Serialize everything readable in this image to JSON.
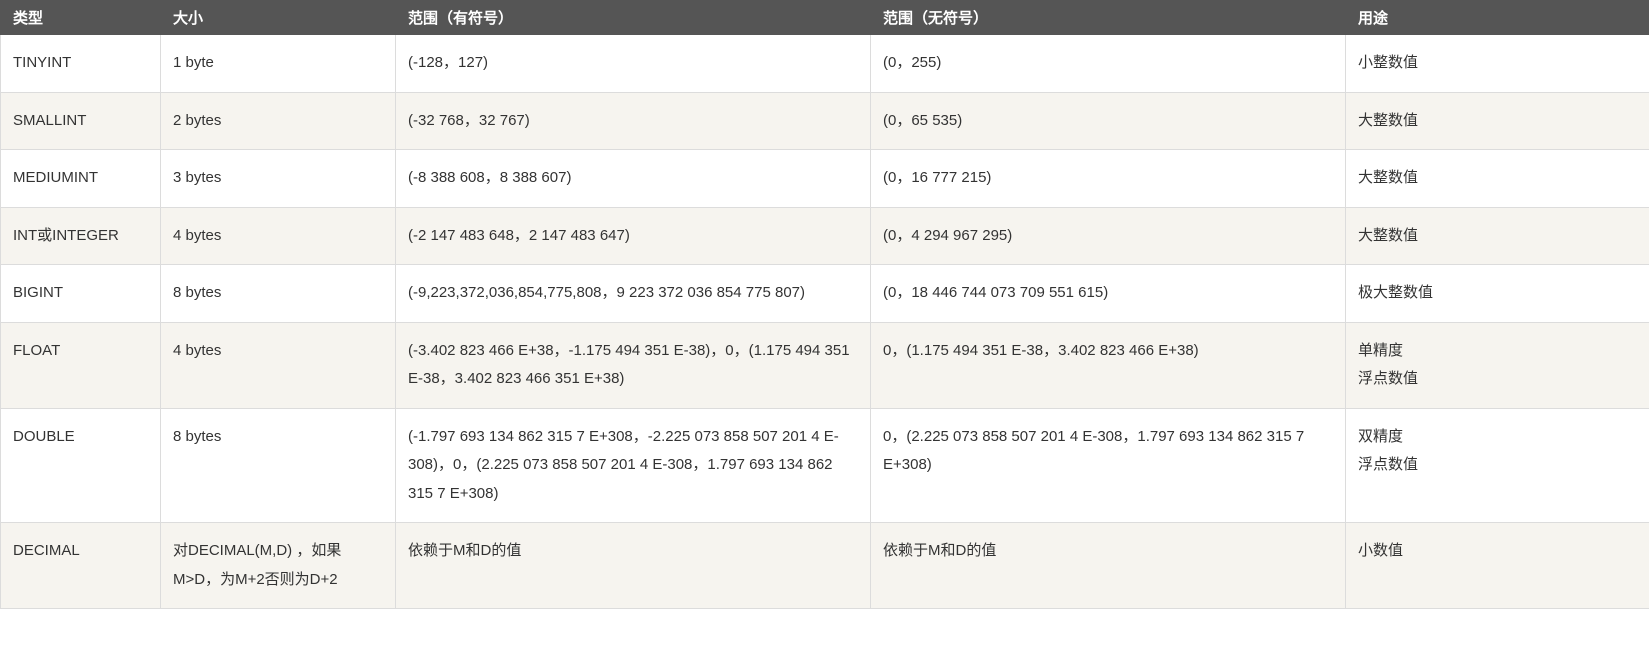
{
  "table": {
    "headers": [
      "类型",
      "大小",
      "范围（有符号）",
      "范围（无符号）",
      "用途"
    ],
    "rows": [
      {
        "type": "TINYINT",
        "size": "1 byte",
        "signed": "(-128，127)",
        "unsigned": "(0，255)",
        "usage": "小整数值"
      },
      {
        "type": "SMALLINT",
        "size": "2 bytes",
        "signed": "(-32 768，32 767)",
        "unsigned": "(0，65 535)",
        "usage": "大整数值"
      },
      {
        "type": "MEDIUMINT",
        "size": "3 bytes",
        "signed": "(-8 388 608，8 388 607)",
        "unsigned": "(0，16 777 215)",
        "usage": "大整数值"
      },
      {
        "type": "INT或INTEGER",
        "size": "4 bytes",
        "signed": "(-2 147 483 648，2 147 483 647)",
        "unsigned": "(0，4 294 967 295)",
        "usage": "大整数值"
      },
      {
        "type": "BIGINT",
        "size": "8 bytes",
        "signed": "(-9,223,372,036,854,775,808，9 223 372 036 854 775 807)",
        "unsigned": "(0，18 446 744 073 709 551 615)",
        "usage": "极大整数值"
      },
      {
        "type": "FLOAT",
        "size": "4 bytes",
        "signed": "(-3.402 823 466 E+38，-1.175 494 351 E-38)，0，(1.175 494 351 E-38，3.402 823 466 351 E+38)",
        "unsigned": "0，(1.175 494 351 E-38，3.402 823 466 E+38)",
        "usage": "单精度\n浮点数值"
      },
      {
        "type": "DOUBLE",
        "size": "8 bytes",
        "signed": "(-1.797 693 134 862 315 7 E+308，-2.225 073 858 507 201 4 E-308)，0，(2.225 073 858 507 201 4 E-308，1.797 693 134 862 315 7 E+308)",
        "unsigned": "0，(2.225 073 858 507 201 4 E-308，1.797 693 134 862 315 7 E+308)",
        "usage": "双精度\n浮点数值"
      },
      {
        "type": "DECIMAL",
        "size": "对DECIMAL(M,D) ，如果M>D，为M+2否则为D+2",
        "signed": "依赖于M和D的值",
        "unsigned": "依赖于M和D的值",
        "usage": "小数值"
      }
    ]
  }
}
